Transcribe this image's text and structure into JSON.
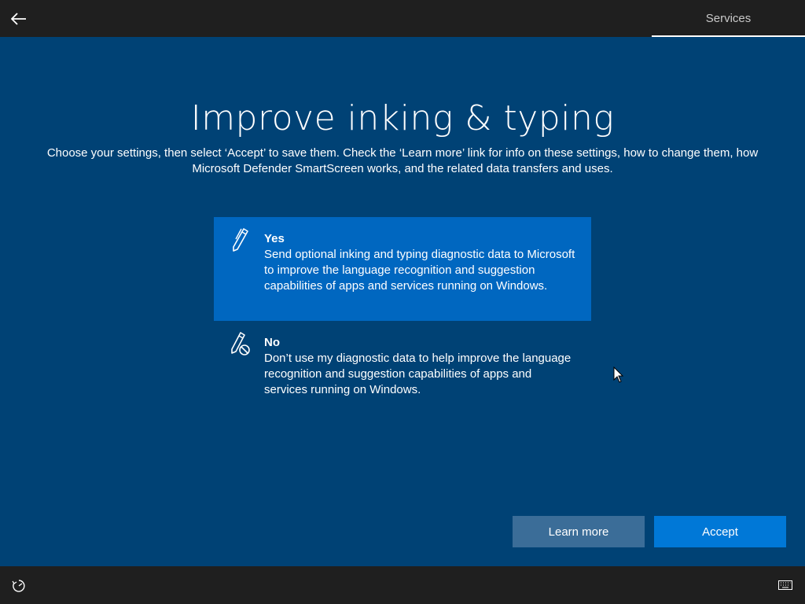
{
  "header": {
    "back_icon": "arrow-left-icon",
    "active_tab": "Services"
  },
  "main": {
    "title": "Improve inking & typing",
    "description": "Choose your settings, then select ‘Accept’ to save them. Check the ‘Learn more’ link for info on these settings, how to change them, how Microsoft Defender SmartScreen works, and the related data transfers and uses.",
    "options": [
      {
        "title": "Yes",
        "text": "Send optional inking and typing diagnostic data to Microsoft to improve the language recognition and suggestion capabilities of apps and services running on Windows.",
        "icon": "pen-icon",
        "selected": true
      },
      {
        "title": "No",
        "text": "Don’t use my diagnostic data to help improve the language recognition and suggestion capabilities of apps and services running on Windows.",
        "icon": "pen-blocked-icon",
        "selected": false
      }
    ],
    "buttons": {
      "learn_more": "Learn more",
      "accept": "Accept"
    }
  },
  "footer": {
    "ease_of_access_icon": "ease-of-access-icon",
    "keyboard_icon": "keyboard-icon"
  },
  "colors": {
    "background": "#004275",
    "bar": "#1f1f1f",
    "selected_option": "#0067c0",
    "accept_button": "#0078d7",
    "learn_more_button": "#3b6d98"
  }
}
